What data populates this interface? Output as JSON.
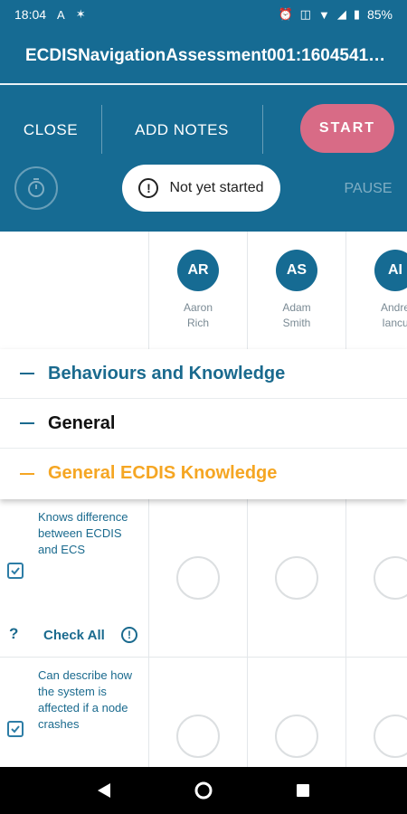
{
  "statusbar": {
    "time": "18:04",
    "battery": "85%"
  },
  "title": "ECDISNavigationAssessment001:1604541…",
  "actions": {
    "close": "CLOSE",
    "add_notes": "ADD NOTES",
    "start": "START",
    "pause": "PAUSE"
  },
  "status": {
    "text": "Not yet started"
  },
  "assessors": [
    {
      "initials": "AR",
      "first": "Aaron",
      "last": "Rich"
    },
    {
      "initials": "AS",
      "first": "Adam",
      "last": "Smith"
    },
    {
      "initials": "AI",
      "first": "Andre",
      "last": "Iancu"
    }
  ],
  "sections": [
    {
      "label": "Behaviours and Knowledge",
      "color": "#1a6a8e"
    },
    {
      "label": "General",
      "color": "#111111"
    },
    {
      "label": "General ECDIS Knowledge",
      "color": "#f5a623"
    }
  ],
  "questions": [
    {
      "text": "Knows difference between ECDIS and ECS"
    },
    {
      "text": "Can describe how the system is affected if a node crashes"
    }
  ],
  "check_all": {
    "label": "Check All",
    "help": "?",
    "info": "!"
  },
  "colors": {
    "primary": "#166b93",
    "accent": "#d86b86",
    "orange": "#f5a623"
  }
}
